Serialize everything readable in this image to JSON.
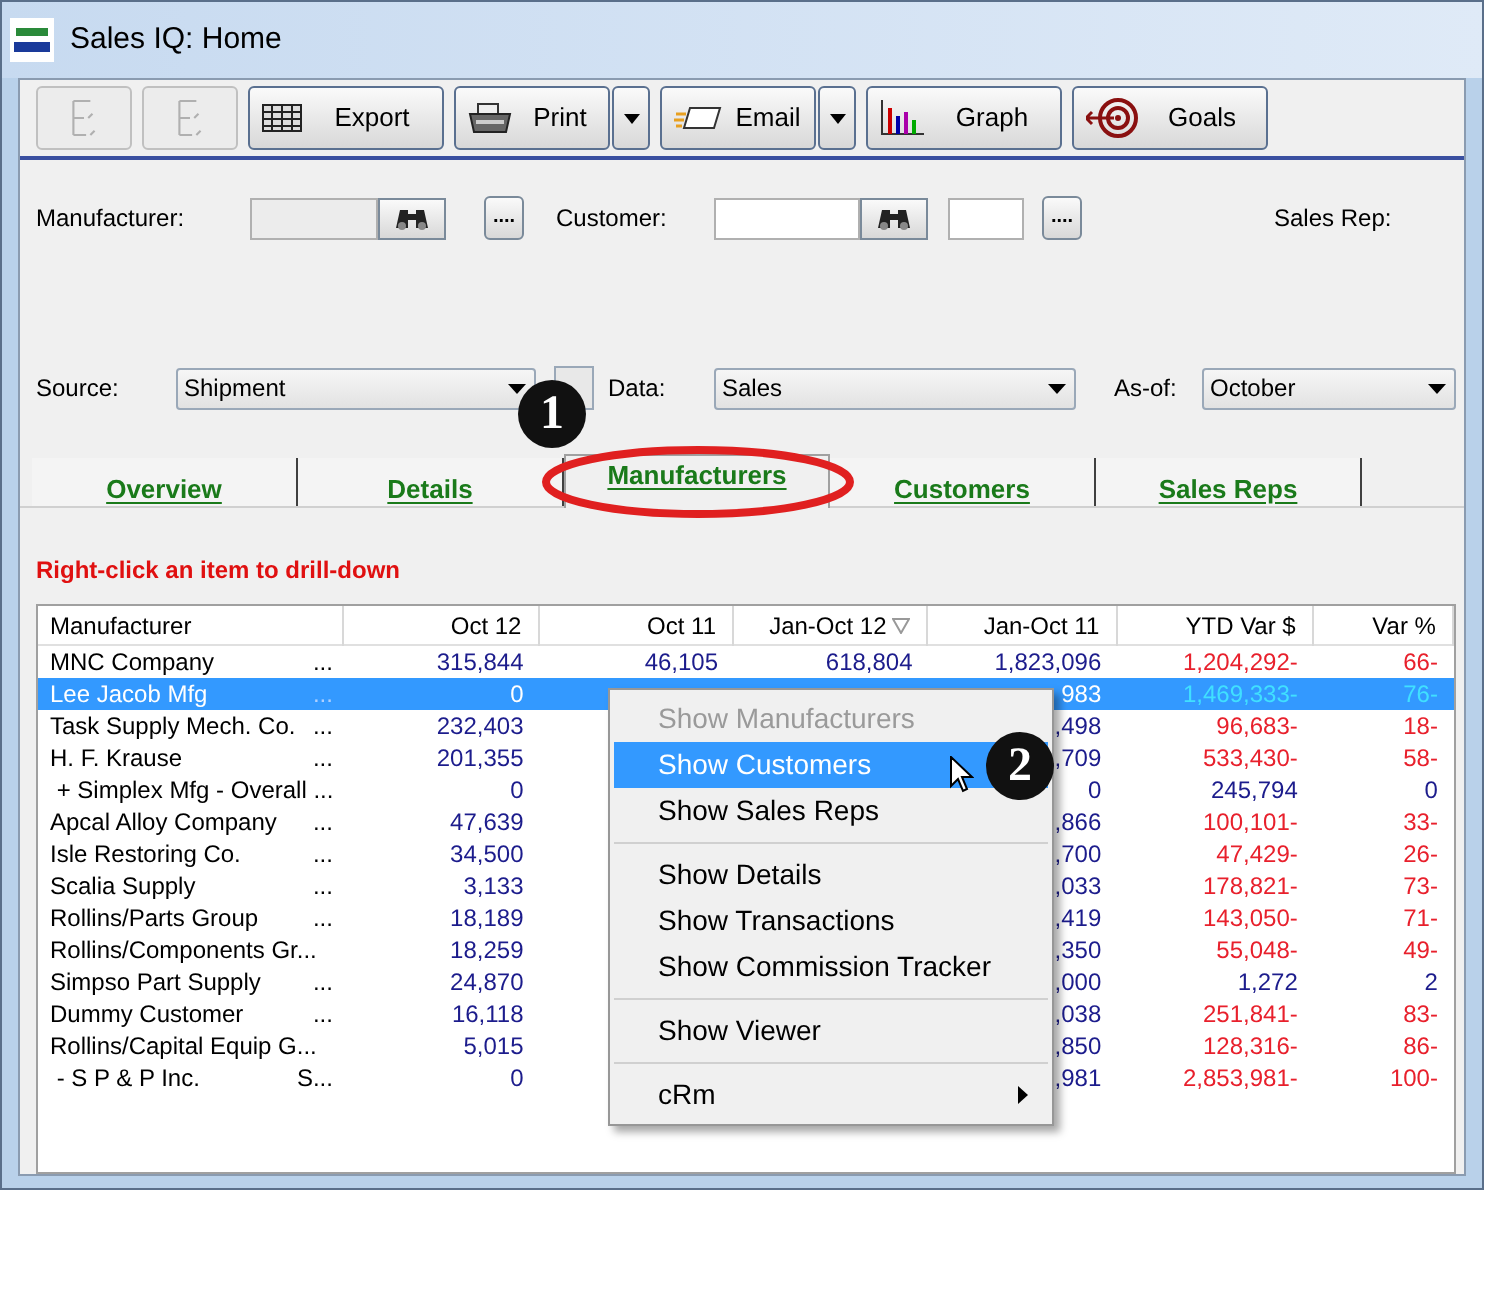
{
  "window": {
    "title": "Sales IQ: Home"
  },
  "toolbar": [
    {
      "kind": "icon",
      "disabled": true
    },
    {
      "kind": "icon",
      "disabled": true
    },
    {
      "kind": "button",
      "label": "Export"
    },
    {
      "kind": "split",
      "label": "Print"
    },
    {
      "kind": "split",
      "label": "Email"
    },
    {
      "kind": "button",
      "label": "Graph"
    },
    {
      "kind": "button",
      "label": "Goals"
    }
  ],
  "filters": {
    "manufacturer_label": "Manufacturer:",
    "customer_label": "Customer:",
    "sales_rep_label": "Sales Rep:",
    "more_button": "....",
    "source": {
      "label": "Source:",
      "value": "Shipment"
    },
    "data": {
      "label": "Data:",
      "value": "Sales"
    },
    "as_of": {
      "label": "As-of:",
      "value": "October"
    }
  },
  "tabs": [
    {
      "label": "Overview",
      "selected": false
    },
    {
      "label": "Details",
      "selected": false
    },
    {
      "label": "Manufacturers",
      "selected": true
    },
    {
      "label": "Customers",
      "selected": false
    },
    {
      "label": "Sales Reps",
      "selected": false
    }
  ],
  "hint": "Right-click an item to drill-down",
  "table": {
    "columns": [
      "Manufacturer",
      "Oct 12",
      "Oct 11",
      "Jan-Oct 12",
      "Jan-Oct 11",
      "YTD Var $",
      "Var %"
    ],
    "rows": [
      {
        "name": "MNC Company",
        "more": "...",
        "oct_12": "315,844",
        "oct_11": "46,105",
        "jan_oct_12": "618,804",
        "jan_oct_11": "1,823,096",
        "ytd_var": "1,204,292-",
        "var_pct": "66-",
        "negative": true,
        "selected": false
      },
      {
        "name": "Lee Jacob Mfg",
        "more": "...",
        "oct_12": "0",
        "jan_oct_11": "983",
        "ytd_var": "1,469,333-",
        "var_pct": "76-",
        "negative": true,
        "selected": true
      },
      {
        "name": "Task Supply Mech. Co.",
        "more": "...",
        "oct_12": "232,403",
        "jan_oct_11": ",498",
        "ytd_var": "96,683-",
        "var_pct": "18-",
        "negative": true,
        "selected": false
      },
      {
        "name": "H. F. Krause",
        "more": "...",
        "oct_12": "201,355",
        "jan_oct_11": ",709",
        "ytd_var": "533,430-",
        "var_pct": "58-",
        "negative": true,
        "selected": false
      },
      {
        "name": " + Simplex Mfg - Overall ...",
        "oct_12": "0",
        "jan_oct_11": "0",
        "ytd_var": "245,794",
        "var_pct": "0",
        "negative": false,
        "selected": false
      },
      {
        "name": "Apcal Alloy Company",
        "more": "...",
        "oct_12": "47,639",
        "jan_oct_11": ",866",
        "ytd_var": "100,101-",
        "var_pct": "33-",
        "negative": true,
        "selected": false
      },
      {
        "name": "Isle Restoring Co.",
        "more": "...",
        "oct_12": "34,500",
        "jan_oct_11": ",700",
        "ytd_var": "47,429-",
        "var_pct": "26-",
        "negative": true,
        "selected": false
      },
      {
        "name": "Scalia Supply",
        "more": "...",
        "oct_12": "3,133",
        "jan_oct_11": ",033",
        "ytd_var": "178,821-",
        "var_pct": "73-",
        "negative": true,
        "selected": false
      },
      {
        "name": "Rollins/Parts Group",
        "more": "...",
        "oct_12": "18,189",
        "jan_oct_11": ",419",
        "ytd_var": "143,050-",
        "var_pct": "71-",
        "negative": true,
        "selected": false
      },
      {
        "name": "Rollins/Components Gr...",
        "oct_12": "18,259",
        "jan_oct_11": ",350",
        "ytd_var": "55,048-",
        "var_pct": "49-",
        "negative": true,
        "selected": false
      },
      {
        "name": "Simpso Part Supply",
        "more": "...",
        "oct_12": "24,870",
        "jan_oct_11": ",000",
        "ytd_var": "1,272",
        "var_pct": "2",
        "negative": false,
        "selected": false
      },
      {
        "name": "Dummy Customer",
        "more": "...",
        "oct_12": "16,118",
        "jan_oct_11": ",038",
        "ytd_var": "251,841-",
        "var_pct": "83-",
        "negative": true,
        "selected": false
      },
      {
        "name": "Rollins/Capital Equip G...",
        "oct_12": "5,015",
        "jan_oct_11": ",850",
        "ytd_var": "128,316-",
        "var_pct": "86-",
        "negative": true,
        "selected": false
      },
      {
        "name": " - S P & P Inc.",
        "more": "S...",
        "oct_12": "0",
        "jan_oct_11": ",981",
        "ytd_var": "2,853,981-",
        "var_pct": "100-",
        "negative": true,
        "selected": false
      }
    ]
  },
  "context_menu": [
    {
      "kind": "item",
      "label": "Show Manufacturers",
      "disabled": true,
      "selected": false
    },
    {
      "kind": "item",
      "label": "Show Customers",
      "disabled": false,
      "selected": true
    },
    {
      "kind": "item",
      "label": "Show Sales Reps",
      "disabled": false,
      "selected": false
    },
    {
      "kind": "separator"
    },
    {
      "kind": "item",
      "label": "Show Details",
      "disabled": false,
      "selected": false
    },
    {
      "kind": "item",
      "label": "Show Transactions",
      "disabled": false,
      "selected": false
    },
    {
      "kind": "item",
      "label": "Show Commission Tracker",
      "disabled": false,
      "selected": false
    },
    {
      "kind": "separator"
    },
    {
      "kind": "item",
      "label": "Show Viewer",
      "disabled": false,
      "selected": false
    },
    {
      "kind": "separator"
    },
    {
      "kind": "submenu",
      "label": "cRm",
      "disabled": false,
      "selected": false
    }
  ],
  "callouts": [
    "1",
    "2"
  ]
}
